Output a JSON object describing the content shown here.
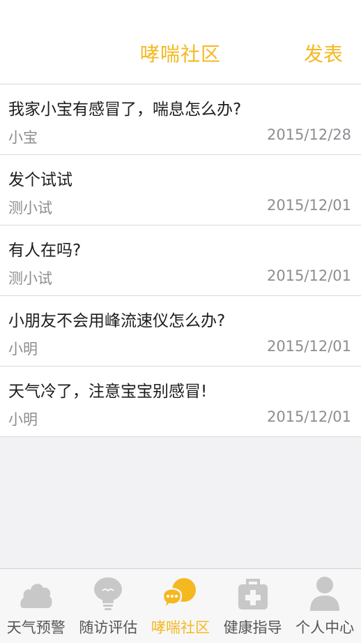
{
  "header": {
    "title": "哮喘社区",
    "action_label": "发表"
  },
  "posts": [
    {
      "title": "我家小宝有感冒了，喘息怎么办?",
      "author": "小宝",
      "date": "2015/12/28"
    },
    {
      "title": "发个试试",
      "author": "测小试",
      "date": "2015/12/01"
    },
    {
      "title": "有人在吗?",
      "author": "测小试",
      "date": "2015/12/01"
    },
    {
      "title": "小朋友不会用峰流速仪怎么办?",
      "author": "小明",
      "date": "2015/12/01"
    },
    {
      "title": "天气冷了，注意宝宝别感冒!",
      "author": "小明",
      "date": "2015/12/01"
    }
  ],
  "tabbar": {
    "items": [
      {
        "label": "天气预警",
        "icon": "cloud-icon",
        "active": false
      },
      {
        "label": "随访评估",
        "icon": "lightbulb-icon",
        "active": false
      },
      {
        "label": "哮喘社区",
        "icon": "chat-bubbles-icon",
        "active": true
      },
      {
        "label": "健康指导",
        "icon": "medical-kit-icon",
        "active": false
      },
      {
        "label": "个人中心",
        "icon": "person-icon",
        "active": false
      }
    ]
  },
  "colors": {
    "accent": "#f5b820",
    "icon_inactive": "#c8c8c8"
  }
}
